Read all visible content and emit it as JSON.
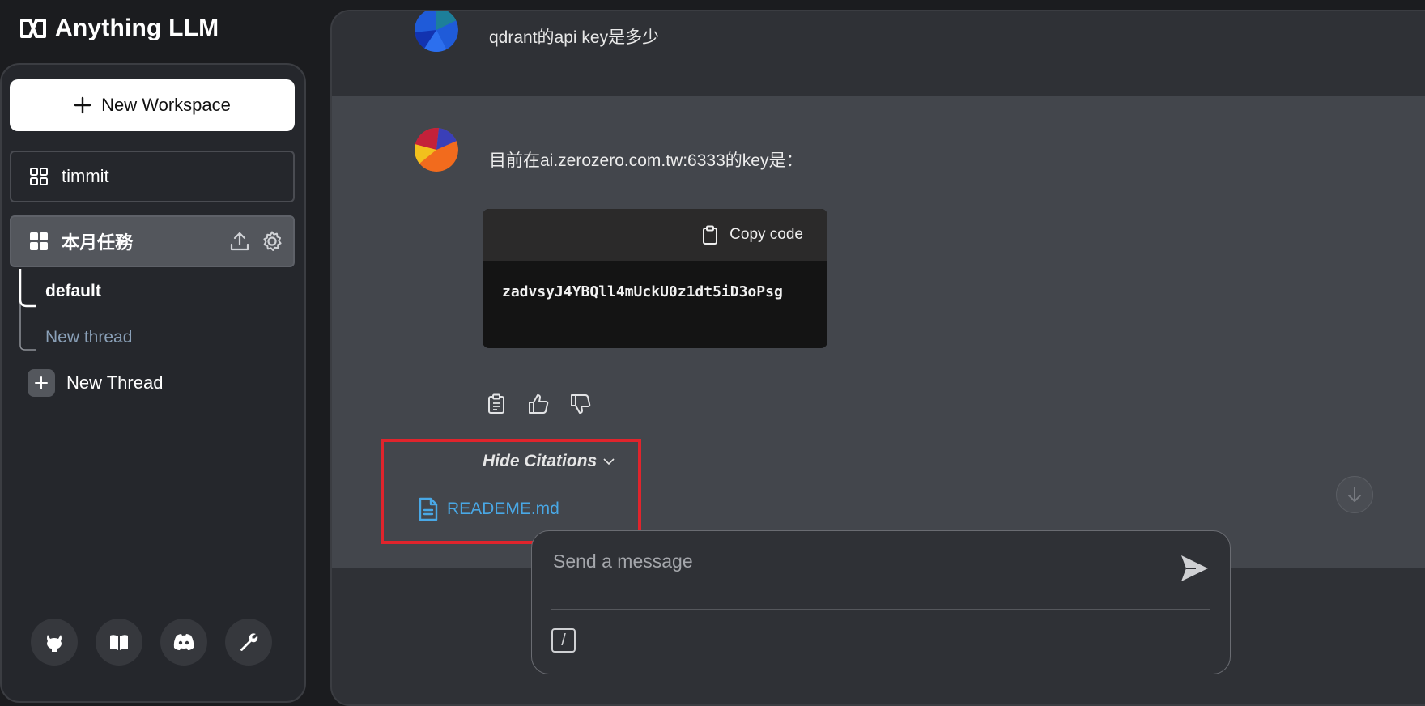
{
  "app": {
    "title": "Anything LLM"
  },
  "sidebar": {
    "new_workspace_label": "New Workspace",
    "workspaces": [
      {
        "label": "timmit"
      },
      {
        "label": "本月任務"
      }
    ],
    "threads": [
      {
        "label": "default"
      },
      {
        "label": "New thread"
      }
    ],
    "new_thread_label": "New Thread",
    "footer_icons": [
      "github-icon",
      "book-icon",
      "discord-icon",
      "wrench-icon"
    ]
  },
  "chat": {
    "user_message": "qdrant的api key是多少",
    "assistant_message": "目前在ai.zerozero.com.tw:6333的key是：",
    "code_block": {
      "copy_label": "Copy code",
      "code": "zadvsyJ4YBQll4mUckU0z1dt5iD3oPsg"
    },
    "citations": {
      "toggle_label": "Hide Citations",
      "items": [
        {
          "label": "READEME.md"
        }
      ]
    }
  },
  "composer": {
    "placeholder": "Send a message",
    "slash_label": "/"
  },
  "colors": {
    "sidebar_bg": "#25272c",
    "panel_bg": "#2f3136",
    "assistant_bg": "#43464c",
    "citation_link": "#49a8e6",
    "highlight_box": "#e0242c"
  }
}
